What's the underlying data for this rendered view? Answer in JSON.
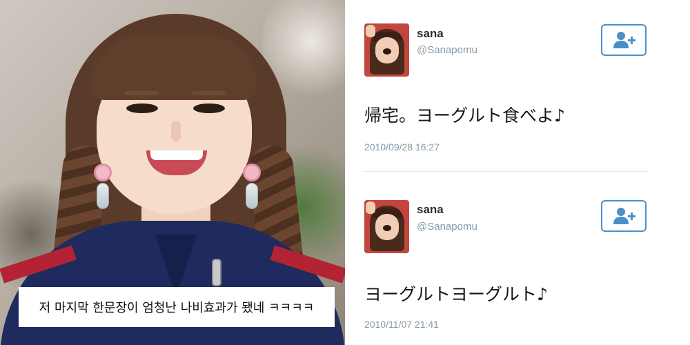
{
  "caption": "저 마지막 한문장이 엄청난 나비효과가 됐네 ㅋㅋㅋㅋ",
  "tweets": [
    {
      "display_name": "sana",
      "handle": "@Sanapomu",
      "text": "帰宅。ヨーグルト食べよ♪",
      "timestamp": "2010/09/28 16:27",
      "follow_icon": "add-user-icon"
    },
    {
      "display_name": "sana",
      "handle": "@Sanapomu",
      "text": "ヨーグルトヨーグルト♪",
      "timestamp": "2010/11/07 21:41",
      "follow_icon": "add-user-icon"
    }
  ],
  "colors": {
    "follow_accent": "#4a90c8",
    "name_text": "#292f33",
    "meta_text": "#8899a6"
  }
}
